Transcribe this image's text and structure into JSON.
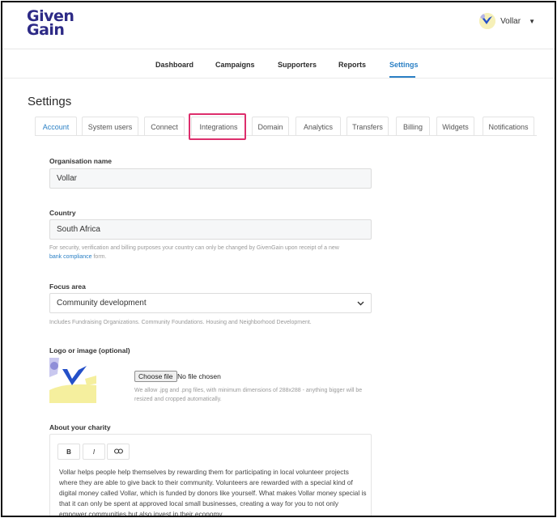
{
  "header": {
    "logo_line1": "Given",
    "logo_line2": "Gain",
    "user_name": "Vollar"
  },
  "nav": {
    "items": [
      {
        "label": "Dashboard"
      },
      {
        "label": "Campaigns"
      },
      {
        "label": "Supporters"
      },
      {
        "label": "Reports"
      },
      {
        "label": "Settings"
      }
    ],
    "active": "Settings"
  },
  "page_title": "Settings",
  "tabs": [
    {
      "label": "Account"
    },
    {
      "label": "System users"
    },
    {
      "label": "Connect"
    },
    {
      "label": "Integrations"
    },
    {
      "label": "Domain"
    },
    {
      "label": "Analytics"
    },
    {
      "label": "Transfers"
    },
    {
      "label": "Billing"
    },
    {
      "label": "Widgets"
    },
    {
      "label": "Notifications"
    }
  ],
  "active_tab": "Account",
  "highlighted_tab": "Integrations",
  "form": {
    "org_name_label": "Organisation name",
    "org_name_value": "Vollar",
    "country_label": "Country",
    "country_value": "South Africa",
    "country_help_pre": "For security, verification and billing purposes your country can only be changed by GivenGain upon receipt of a new",
    "country_help_link": "bank compliance",
    "country_help_post": "form.",
    "focus_label": "Focus area",
    "focus_value": "Community development",
    "focus_help": "Includes Fundraising Organizations. Community Foundations. Housing and Neighborhood Development.",
    "logo_label": "Logo or image (optional)",
    "file_button": "Choose file",
    "file_status": "No file chosen",
    "file_help": "We allow .jpg and .png files, with minimum dimensions of 288x288 - anything bigger will be resized and cropped automatically.",
    "about_label": "About your charity",
    "editor_bold": "B",
    "editor_italic": "I",
    "about_text": "Vollar helps people help themselves by rewarding them for participating in local volunteer projects where they are able to give back to their community. Volunteers are rewarded with a special kind of digital money called Vollar, which is funded by donors like yourself. What makes Vollar money special is that it can only be spent at approved local small businesses, creating a way for you to not only empower communities but also invest in their economy."
  },
  "colors": {
    "brand": "#2d2a86",
    "accent": "#2b80c5",
    "highlight": "#dd2e6c"
  }
}
